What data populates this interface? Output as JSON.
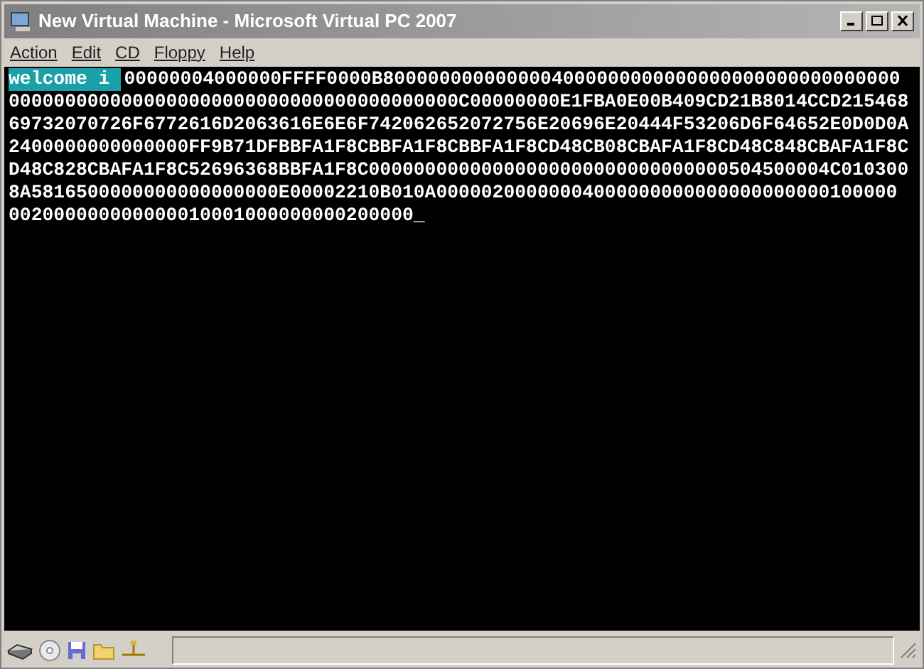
{
  "window": {
    "title": "New Virtual Machine - Microsoft Virtual PC 2007"
  },
  "menu": [
    "Action",
    "Edit",
    "CD",
    "Floppy",
    "Help"
  ],
  "console": {
    "highlight": "welcome i",
    "lines": [
      "00000004000000FFFF0000B8000000000000004000000000000000000000000000000",
      "0000000000000000000000000000000000000000C00000000E1FBA0E00B409CD21B8014CCD215468",
      "69732070726F6772616D2063616E6E6F742062652072756E20696E20444F53206D6F64652E0D0D0A",
      "2400000000000000FF9B71DFBBFA1F8CBBFA1F8CBBFA1F8CD48CB08CBAFA1F8CD48C848CBAFA1F8C",
      "D48C828CBAFA1F8C52696368BBFA1F8C00000000000000000000000000000000504500004C010300",
      "8A5816500000000000000000E00002210B010A00000200000004000000000000000000000100000",
      "002000000000000010001000000000200000"
    ],
    "cursor": "_"
  }
}
